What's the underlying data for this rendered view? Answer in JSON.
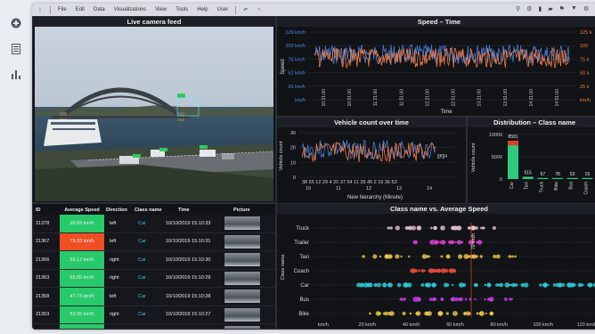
{
  "menu": [
    "File",
    "Edit",
    "Data",
    "Visualizations",
    "View",
    "Tools",
    "Help",
    "User"
  ],
  "panels": {
    "camera": "Live camera feed",
    "speed_time": "Speed – Time",
    "vehicle_count": "Vehicle count over time",
    "distribution": "Distribution – Class name",
    "classname_speed": "Class name vs. Average Speed"
  },
  "table": {
    "headers": [
      "ID",
      "Average Speed",
      "Direction",
      "Class name",
      "Time",
      "Picture"
    ],
    "rows": [
      {
        "id": "21378",
        "speed": "28.69 km/h",
        "dir": "left",
        "cls": "Car",
        "time": "10/10/2019 15:10:33",
        "color": "#28c96a"
      },
      {
        "id": "21367",
        "speed": "79.33 km/h",
        "dir": "left",
        "cls": "Car",
        "time": "10/10/2019 15:10:31",
        "color": "#f04e23"
      },
      {
        "id": "21366",
        "speed": "59.12 km/h",
        "dir": "right",
        "cls": "Car",
        "time": "10/10/2019 15:10:30",
        "color": "#28c96a"
      },
      {
        "id": "21363",
        "speed": "65.05 km/h",
        "dir": "right",
        "cls": "Car",
        "time": "10/10/2019 15:10:29",
        "color": "#28c96a"
      },
      {
        "id": "21358",
        "speed": "47.74 km/h",
        "dir": "left",
        "cls": "Car",
        "time": "10/10/2019 15:10:28",
        "color": "#28c96a"
      },
      {
        "id": "21353",
        "speed": "53.95 km/h",
        "dir": "right",
        "cls": "Car",
        "time": "10/10/2019 15:10:27",
        "color": "#28c96a"
      },
      {
        "id": "21352",
        "speed": "65.71 km/h",
        "dir": "right",
        "cls": "Car",
        "time": "10/10/2019 15:10:25",
        "color": "#28c96a"
      }
    ]
  },
  "speed_time": {
    "ylabel": "Speed",
    "xlabel": "Time",
    "yticks": [
      "129 km/h",
      "103 km/h",
      "78 km/h",
      "52 km/h",
      "26 km/h",
      "km/h"
    ],
    "rticks": [
      "125 k",
      "100",
      "75 k",
      "50 k",
      "25 k",
      "km/h"
    ],
    "xticks": [
      "10:21:00",
      "10:51:00",
      "11:21:00",
      "11:51:00",
      "12:21:00",
      "12:51:00",
      "13:21:00",
      "13:51:00",
      "14:21:00",
      "14:51:00"
    ]
  },
  "vehicle_count": {
    "ylabel": "Vehicle count",
    "xlabel": "New hierarchy (Minute)",
    "yticks": [
      "30",
      "20",
      "10",
      "0"
    ],
    "minute_ticks": [
      "38 55 12 29 4 20 37 54 11 28 45 2 19 36 53"
    ],
    "hour_ticks": [
      "10",
      "11",
      "12",
      "13",
      "14"
    ],
    "annotation": "[[ff]]4"
  },
  "chart_data": {
    "type": "bar",
    "title": "Distribution – Class name",
    "ylabel": "Vehicle count",
    "categories": [
      "Car",
      "Taxi",
      "Truck",
      "Bike",
      "Bus",
      "Coach"
    ],
    "values": [
      8591,
      515,
      97,
      78,
      53,
      15
    ],
    "yticks": [
      "10000",
      "5000",
      "0"
    ],
    "ylim": [
      0,
      10000
    ]
  },
  "scatter": {
    "ylabel": "Class name",
    "categories": [
      "Truck",
      "Trailer",
      "Taxi",
      "Coach",
      "Car",
      "Bus",
      "Bike"
    ],
    "xticks": [
      "km/h",
      "20 km/h",
      "40 km/h",
      "60 km/h",
      "80 km/h",
      "100 km/h",
      "120 km/h"
    ],
    "marker_label": "70 km/h"
  },
  "colors": {
    "blue": "#4a7fd4",
    "orange": "#f07c4a",
    "green": "#2ec97e",
    "red": "#e53a2a"
  }
}
